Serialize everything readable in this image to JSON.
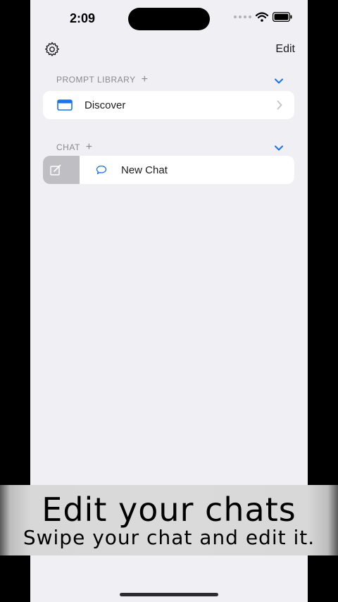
{
  "status_bar": {
    "time": "2:09"
  },
  "toolbar": {
    "edit_label": "Edit"
  },
  "sections": {
    "prompt_library": {
      "title": "PROMPT LIBRARY",
      "plus": "+",
      "items": [
        {
          "label": "Discover"
        }
      ]
    },
    "chat": {
      "title": "CHAT",
      "plus": "+",
      "items": [
        {
          "label": "New Chat"
        }
      ]
    }
  },
  "banner": {
    "title": "Edit your chats",
    "subtitle": "Swipe your chat and edit it."
  },
  "colors": {
    "accent": "#1a73e8",
    "background": "#efeff4",
    "card": "#ffffff",
    "swipe_action": "#bfbfc3"
  },
  "icons": [
    "gear-icon",
    "wifi-icon",
    "battery-icon",
    "plus-icon",
    "chevron-down-icon",
    "window-icon",
    "chevron-right-icon",
    "compose-icon",
    "chat-bubble-icon"
  ]
}
